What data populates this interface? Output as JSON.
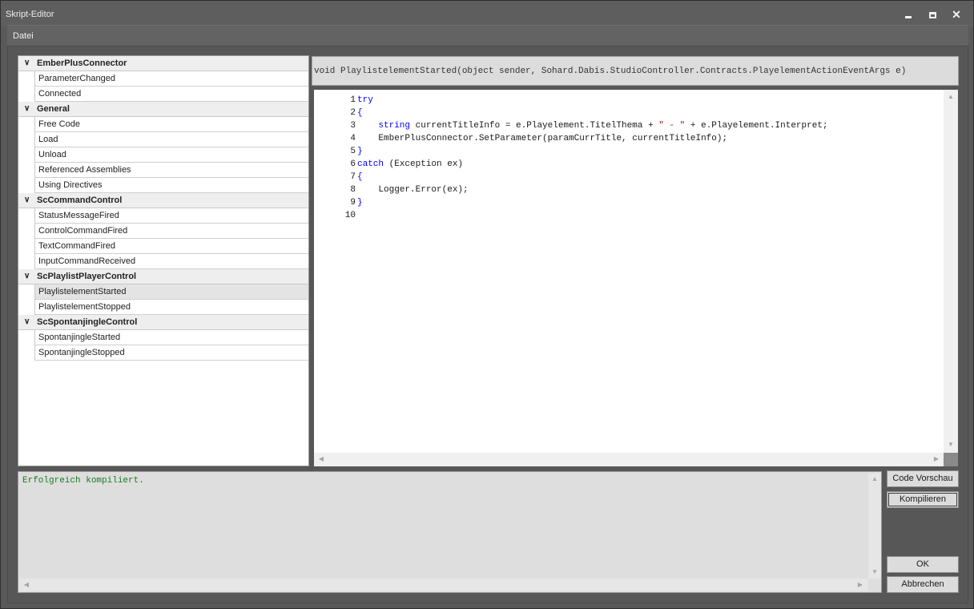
{
  "window": {
    "title": "Skript-Editor",
    "minimize_icon": "minimize-icon",
    "maximize_icon": "maximize-icon",
    "close_label": "✕"
  },
  "menu": {
    "file": "Datei"
  },
  "tree": {
    "groups": [
      {
        "label": "EmberPlusConnector",
        "children": [
          "ParameterChanged",
          "Connected"
        ]
      },
      {
        "label": "General",
        "children": [
          "Free Code",
          "Load",
          "Unload",
          "Referenced Assemblies",
          "Using Directives"
        ]
      },
      {
        "label": "ScCommandControl",
        "children": [
          "StatusMessageFired",
          "ControlCommandFired",
          "TextCommandFired",
          "InputCommandReceived"
        ]
      },
      {
        "label": "ScPlaylistPlayerControl",
        "children": [
          "PlaylistelementStarted",
          "PlaylistelementStopped"
        ]
      },
      {
        "label": "ScSpontanjingleControl",
        "children": [
          "SpontanjingleStarted",
          "SpontanjingleStopped"
        ]
      }
    ],
    "selected": "PlaylistelementStarted"
  },
  "editor": {
    "signature": "void PlaylistelementStarted(object sender, Sohard.Dabis.StudioController.Contracts.PlayelementActionEventArgs e)",
    "lines": [
      {
        "n": "1",
        "parts": [
          {
            "t": "try",
            "c": "kw"
          }
        ]
      },
      {
        "n": "2",
        "parts": [
          {
            "t": "{",
            "c": "kw"
          }
        ]
      },
      {
        "n": "3",
        "parts": [
          {
            "t": "    ",
            "c": ""
          },
          {
            "t": "string",
            "c": "kw"
          },
          {
            "t": " currentTitleInfo = e.Playelement.TitelThema + ",
            "c": ""
          },
          {
            "t": "\" - \"",
            "c": "str"
          },
          {
            "t": " + e.Playelement.Interpret;",
            "c": ""
          }
        ]
      },
      {
        "n": "4",
        "parts": [
          {
            "t": "    EmberPlusConnector.SetParameter(paramCurrTitle, currentTitleInfo);",
            "c": ""
          }
        ]
      },
      {
        "n": "5",
        "parts": [
          {
            "t": "}",
            "c": "kw"
          }
        ]
      },
      {
        "n": "6",
        "parts": [
          {
            "t": "catch",
            "c": "kw"
          },
          {
            "t": " (Exception ex)",
            "c": ""
          }
        ]
      },
      {
        "n": "7",
        "parts": [
          {
            "t": "{",
            "c": "kw"
          }
        ]
      },
      {
        "n": "8",
        "parts": [
          {
            "t": "    Logger.Error(ex);",
            "c": ""
          }
        ]
      },
      {
        "n": "9",
        "parts": [
          {
            "t": "}",
            "c": "kw"
          }
        ]
      },
      {
        "n": "10",
        "parts": []
      }
    ]
  },
  "output": {
    "message": "Erfolgreich kompiliert."
  },
  "buttons": {
    "preview": "Code Vorschau",
    "compile": "Kompilieren",
    "ok": "OK",
    "cancel": "Abbrechen"
  },
  "colors": {
    "keyword": "#0000ff",
    "string": "#a31515",
    "success": "#1e7a1e"
  }
}
